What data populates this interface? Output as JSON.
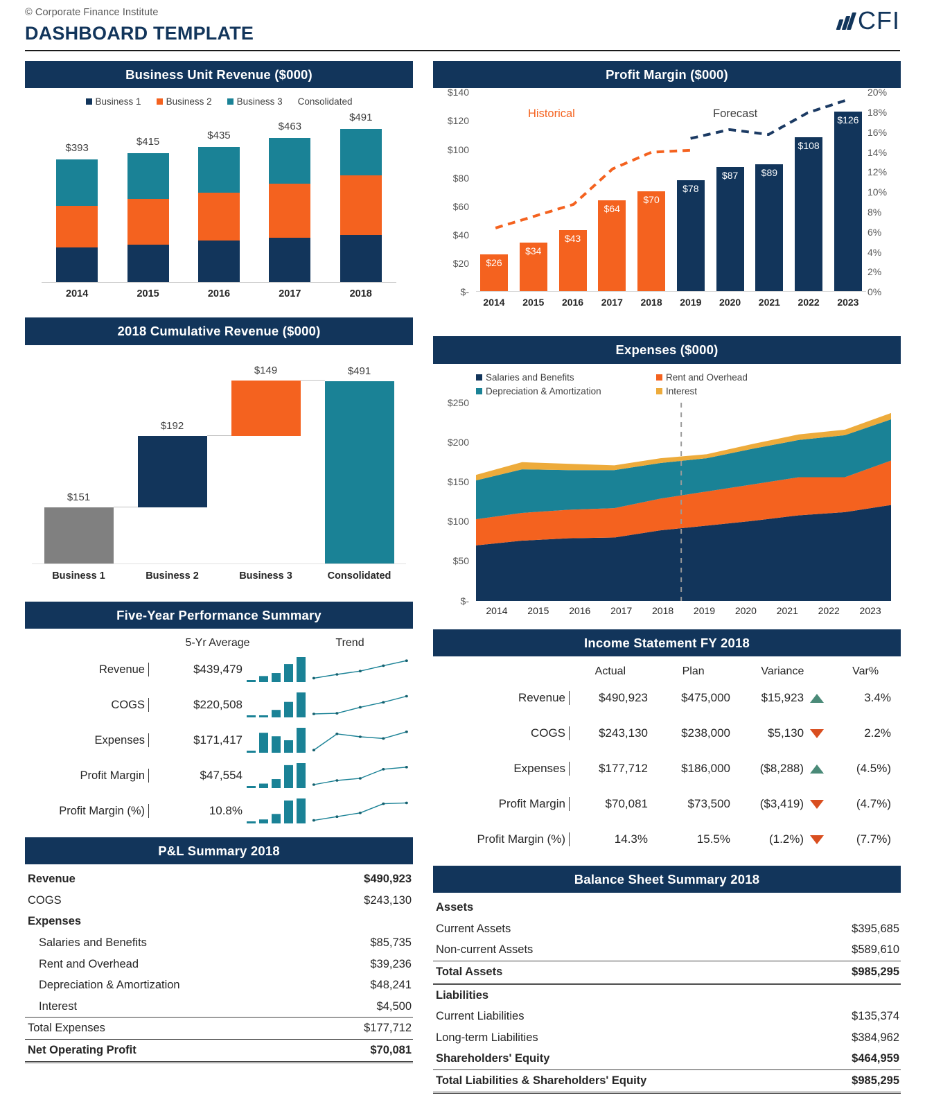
{
  "header": {
    "copyright": "© Corporate Finance Institute",
    "title": "DASHBOARD TEMPLATE",
    "brand_text": "CFI"
  },
  "colors": {
    "navy": "#12355b",
    "orange": "#f4621f",
    "teal": "#1a8296",
    "gray": "#808080",
    "amber": "#edab3b",
    "up": "#4a8a78",
    "down": "#d94e1f"
  },
  "panels": {
    "business_unit_revenue": {
      "title": "Business Unit Revenue ($000)"
    },
    "profit_margin": {
      "title": "Profit Margin ($000)"
    },
    "cumulative_revenue": {
      "title": "2018 Cumulative Revenue ($000)"
    },
    "expenses": {
      "title": "Expenses ($000)"
    },
    "five_year": {
      "title": "Five-Year Performance Summary"
    },
    "income_statement": {
      "title": "Income Statement FY 2018"
    },
    "pl_summary": {
      "title": "P&L Summary 2018"
    },
    "balance_sheet": {
      "title": "Balance Sheet Summary 2018"
    }
  },
  "chart_data": [
    {
      "id": "business_unit_revenue",
      "type": "bar",
      "title": "Business Unit Revenue ($000)",
      "stacked": true,
      "categories": [
        "2014",
        "2015",
        "2016",
        "2017",
        "2018"
      ],
      "legend": [
        "Business 1",
        "Business 2",
        "Business 3",
        "Consolidated"
      ],
      "legend_position": "top",
      "series": [
        {
          "name": "Business 1",
          "color": "#12355b",
          "values": [
            112,
            121,
            133,
            142,
            151
          ]
        },
        {
          "name": "Business 2",
          "color": "#f4621f",
          "values": [
            133,
            147,
            155,
            175,
            192
          ]
        },
        {
          "name": "Business 3",
          "color": "#1a8296",
          "values": [
            148,
            147,
            147,
            146,
            149
          ]
        }
      ],
      "totals": [
        "$393",
        "$415",
        "$435",
        "$463",
        "$491"
      ],
      "total_values": [
        393,
        415,
        435,
        463,
        491
      ],
      "ylim": [
        0,
        560
      ],
      "grid": false
    },
    {
      "id": "profit_margin",
      "type": "bar",
      "title": "Profit Margin ($000)",
      "categories": [
        "2014",
        "2015",
        "2016",
        "2017",
        "2018",
        "2019",
        "2020",
        "2021",
        "2022",
        "2023"
      ],
      "bar_values": [
        26,
        34,
        43,
        64,
        70,
        78,
        87,
        89,
        108,
        126
      ],
      "bar_labels": [
        "$26",
        "$34",
        "$43",
        "$64",
        "$70",
        "$78",
        "$87",
        "$89",
        "$108",
        "$126"
      ],
      "bar_colors": [
        "#f4621f",
        "#f4621f",
        "#f4621f",
        "#f4621f",
        "#f4621f",
        "#12355b",
        "#12355b",
        "#12355b",
        "#12355b",
        "#12355b"
      ],
      "line_historical": [
        6.2,
        7.4,
        8.6,
        12.2,
        13.9,
        14.1
      ],
      "line_forecast": [
        15.3,
        16.2,
        15.7,
        17.9,
        19.2
      ],
      "annotations": [
        {
          "text": "Historical",
          "color": "#f4621f"
        },
        {
          "text": "Forecast",
          "color": "#404040"
        }
      ],
      "ytick_labels": [
        "$140",
        "$120",
        "$100",
        "$80",
        "$60",
        "$40",
        "$20",
        "$-"
      ],
      "ytick_values": [
        140,
        120,
        100,
        80,
        60,
        40,
        20,
        0
      ],
      "y2tick_labels": [
        "20%",
        "18%",
        "16%",
        "14%",
        "12%",
        "10%",
        "8%",
        "6%",
        "4%",
        "2%",
        "0%"
      ],
      "y2tick_values": [
        20,
        18,
        16,
        14,
        12,
        10,
        8,
        6,
        4,
        2,
        0
      ],
      "ylim": [
        0,
        140
      ],
      "y2lim": [
        0,
        20
      ],
      "grid": false
    },
    {
      "id": "cumulative_revenue",
      "type": "bar",
      "title": "2018 Cumulative Revenue ($000)",
      "waterfall": true,
      "categories": [
        "Business 1",
        "Business 2",
        "Business 3",
        "Consolidated"
      ],
      "values": [
        151,
        192,
        149,
        491
      ],
      "labels": [
        "$151",
        "$192",
        "$149",
        "$491"
      ],
      "bases": [
        0,
        151,
        343,
        0
      ],
      "colors": [
        "#808080",
        "#12355b",
        "#f4621f",
        "#1a8296"
      ],
      "ylim": [
        0,
        560
      ],
      "grid": false
    },
    {
      "id": "expenses",
      "type": "area",
      "title": "Expenses ($000)",
      "stacked": true,
      "x": [
        "2014",
        "2015",
        "2016",
        "2017",
        "2018",
        "2019",
        "2020",
        "2021",
        "2022",
        "2023"
      ],
      "legend": [
        "Salaries and Benefits",
        "Rent and Overhead",
        "Depreciation & Amortization",
        "Interest"
      ],
      "legend_position": "top-left",
      "series": [
        {
          "name": "Salaries and Benefits",
          "color": "#12355b",
          "values": [
            70,
            76,
            79,
            80,
            89,
            95,
            101,
            108,
            112,
            121
          ]
        },
        {
          "name": "Rent and Overhead",
          "color": "#f4621f",
          "values": [
            33,
            35,
            36,
            37,
            40,
            43,
            46,
            48,
            44,
            56
          ]
        },
        {
          "name": "Depreciation & Amortization",
          "color": "#1a8296",
          "values": [
            49,
            55,
            50,
            48,
            45,
            42,
            45,
            47,
            53,
            52
          ]
        },
        {
          "name": "Interest",
          "color": "#edab3b",
          "values": [
            7,
            9,
            8,
            6,
            6,
            5,
            6,
            7,
            7,
            8
          ]
        }
      ],
      "ytick_labels": [
        "$250",
        "$200",
        "$150",
        "$100",
        "$50",
        "$-"
      ],
      "ytick_values": [
        250,
        200,
        150,
        100,
        50,
        0
      ],
      "ylim": [
        0,
        250
      ],
      "divider_after": "2018",
      "grid": false
    }
  ],
  "five_year": {
    "col_headers": [
      "",
      "5-Yr Average",
      "Trend"
    ],
    "rows": [
      {
        "label": "Revenue",
        "average": "$439,479",
        "sparkline": [
          0.04,
          0.24,
          0.36,
          0.72,
          1.0
        ],
        "trend": [
          0.12,
          0.3,
          0.46,
          0.72,
          0.96
        ]
      },
      {
        "label": "COGS",
        "average": "$220,508",
        "sparkline": [
          0.03,
          0.05,
          0.3,
          0.62,
          1.0
        ],
        "trend": [
          0.1,
          0.13,
          0.42,
          0.66,
          0.95
        ]
      },
      {
        "label": "Expenses",
        "average": "$171,417",
        "sparkline": [
          0.05,
          0.8,
          0.66,
          0.5,
          1.0
        ],
        "trend": [
          0.06,
          0.84,
          0.7,
          0.62,
          0.94
        ]
      },
      {
        "label": "Profit Margin",
        "average": "$47,554",
        "sparkline": [
          0.04,
          0.18,
          0.36,
          0.92,
          1.0
        ],
        "trend": [
          0.1,
          0.3,
          0.4,
          0.84,
          0.94
        ]
      },
      {
        "label": "Profit Margin (%)",
        "average": "10.8%",
        "sparkline": [
          0.04,
          0.16,
          0.38,
          0.92,
          1.0
        ],
        "trend": [
          0.08,
          0.26,
          0.44,
          0.88,
          0.92
        ]
      }
    ]
  },
  "income_statement": {
    "col_headers": [
      "Actual",
      "Plan",
      "Variance",
      "Var%"
    ],
    "rows": [
      {
        "label": "Revenue",
        "actual": "$490,923",
        "plan": "$475,000",
        "variance": "$15,923",
        "direction": "up",
        "varpct": "3.4%"
      },
      {
        "label": "COGS",
        "actual": "$243,130",
        "plan": "$238,000",
        "variance": "$5,130",
        "direction": "down",
        "varpct": "2.2%"
      },
      {
        "label": "Expenses",
        "actual": "$177,712",
        "plan": "$186,000",
        "variance": "($8,288)",
        "direction": "up",
        "varpct": "(4.5%)"
      },
      {
        "label": "Profit Margin",
        "actual": "$70,081",
        "plan": "$73,500",
        "variance": "($3,419)",
        "direction": "down",
        "varpct": "(4.7%)"
      },
      {
        "label": "Profit Margin (%)",
        "actual": "14.3%",
        "plan": "15.5%",
        "variance": "(1.2%)",
        "direction": "down",
        "varpct": "(7.7%)"
      }
    ]
  },
  "pl_summary": {
    "rows": [
      {
        "label": "Revenue",
        "value": "$490,923",
        "bold": true,
        "indent": false,
        "rule": ""
      },
      {
        "label": "COGS",
        "value": "$243,130",
        "bold": false,
        "indent": false,
        "rule": ""
      },
      {
        "label": "Expenses",
        "value": "",
        "bold": true,
        "indent": false,
        "rule": ""
      },
      {
        "label": "Salaries and Benefits",
        "value": "$85,735",
        "bold": false,
        "indent": true,
        "rule": ""
      },
      {
        "label": "Rent and Overhead",
        "value": "$39,236",
        "bold": false,
        "indent": true,
        "rule": ""
      },
      {
        "label": "Depreciation & Amortization",
        "value": "$48,241",
        "bold": false,
        "indent": true,
        "rule": ""
      },
      {
        "label": "Interest",
        "value": "$4,500",
        "bold": false,
        "indent": true,
        "rule": ""
      },
      {
        "label": "Total Expenses",
        "value": "$177,712",
        "bold": false,
        "indent": false,
        "rule": "top"
      },
      {
        "label": "Net Operating Profit",
        "value": "$70,081",
        "bold": true,
        "indent": false,
        "rule": "top-dbl"
      }
    ]
  },
  "balance_sheet": {
    "rows": [
      {
        "label": "Assets",
        "value": "",
        "bold": true,
        "indent": false,
        "rule": ""
      },
      {
        "label": "Current Assets",
        "value": "$395,685",
        "bold": false,
        "indent": false,
        "rule": ""
      },
      {
        "label": "Non-current Assets",
        "value": "$589,610",
        "bold": false,
        "indent": false,
        "rule": ""
      },
      {
        "label": "Total Assets",
        "value": "$985,295",
        "bold": true,
        "indent": false,
        "rule": "top-dbl"
      },
      {
        "label": "Liabilities",
        "value": "",
        "bold": true,
        "indent": false,
        "rule": ""
      },
      {
        "label": "Current Liabilities",
        "value": "$135,374",
        "bold": false,
        "indent": false,
        "rule": ""
      },
      {
        "label": "Long-term Liabilities",
        "value": "$384,962",
        "bold": false,
        "indent": false,
        "rule": ""
      },
      {
        "label": "Shareholders' Equity",
        "value": "$464,959",
        "bold": true,
        "indent": false,
        "rule": ""
      },
      {
        "label": "Total Liabilities & Shareholders' Equity",
        "value": "$985,295",
        "bold": true,
        "indent": false,
        "rule": "top-dbl"
      }
    ]
  }
}
